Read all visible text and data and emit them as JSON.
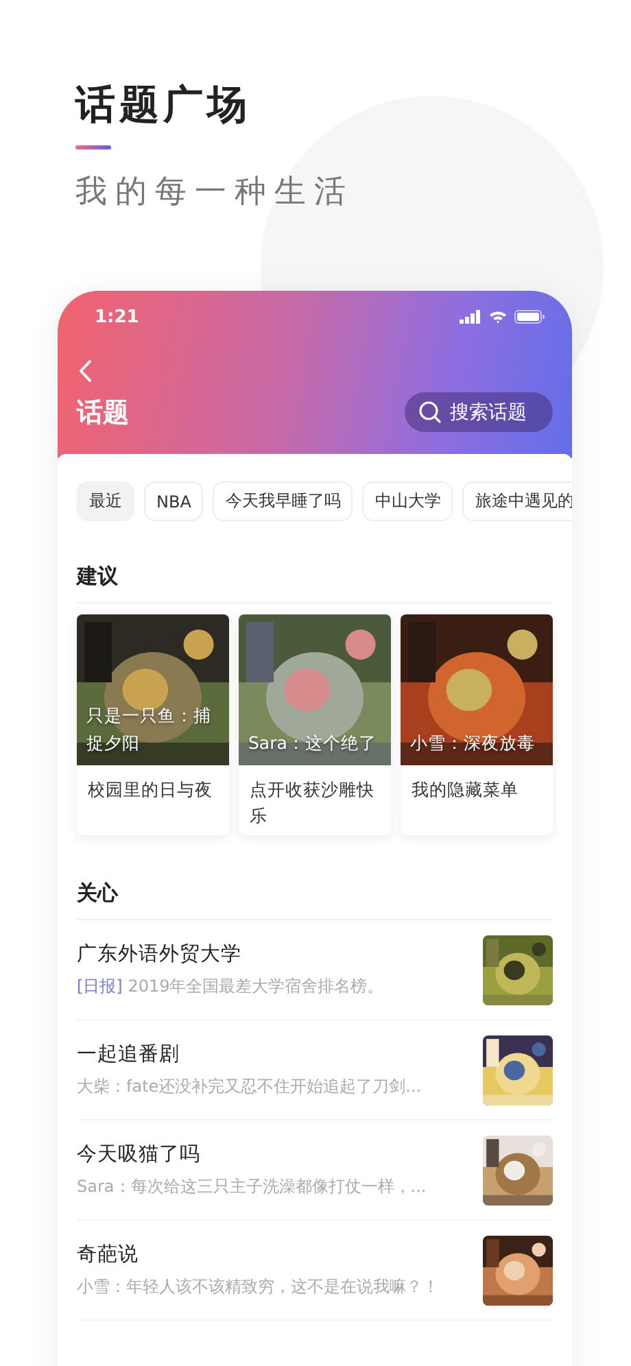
{
  "page": {
    "title": "话题广场",
    "subtitle": "我的每一种生活"
  },
  "phone": {
    "status_bar": {
      "time": "1:21"
    },
    "header": {
      "title": "话题",
      "search": {
        "placeholder": "搜索话题"
      }
    },
    "chips": [
      {
        "label": "最近",
        "selected": true
      },
      {
        "label": "NBA",
        "selected": false
      },
      {
        "label": "今天我早睡了吗",
        "selected": false
      },
      {
        "label": "中山大学",
        "selected": false
      },
      {
        "label": "旅途中遇见的",
        "selected": false
      }
    ],
    "suggest": {
      "title": "建议",
      "cards": [
        {
          "caption": "只是一只鱼：捕捉夕阳",
          "title": "校园里的日与夜"
        },
        {
          "caption": "Sara：这个绝了",
          "title": "点开收获沙雕快乐"
        },
        {
          "caption": "小雪：深夜放毒",
          "title": "我的隐藏菜单"
        }
      ]
    },
    "follow": {
      "title": "关心",
      "items": [
        {
          "title": "广东外语外贸大学",
          "tag": "[日报]",
          "text": "2019年全国最差大学宿舍排名榜。"
        },
        {
          "title": "一起追番剧",
          "text": "大柴：fate还没补完又忍不住开始追起了刀剑..."
        },
        {
          "title": "今天吸猫了吗",
          "text": "Sara：每次给这三只主子洗澡都像打仗一样，..."
        },
        {
          "title": "奇葩说",
          "text": "小雪：年轻人该不该精致穷，这不是在说我嘛？！"
        }
      ]
    }
  }
}
